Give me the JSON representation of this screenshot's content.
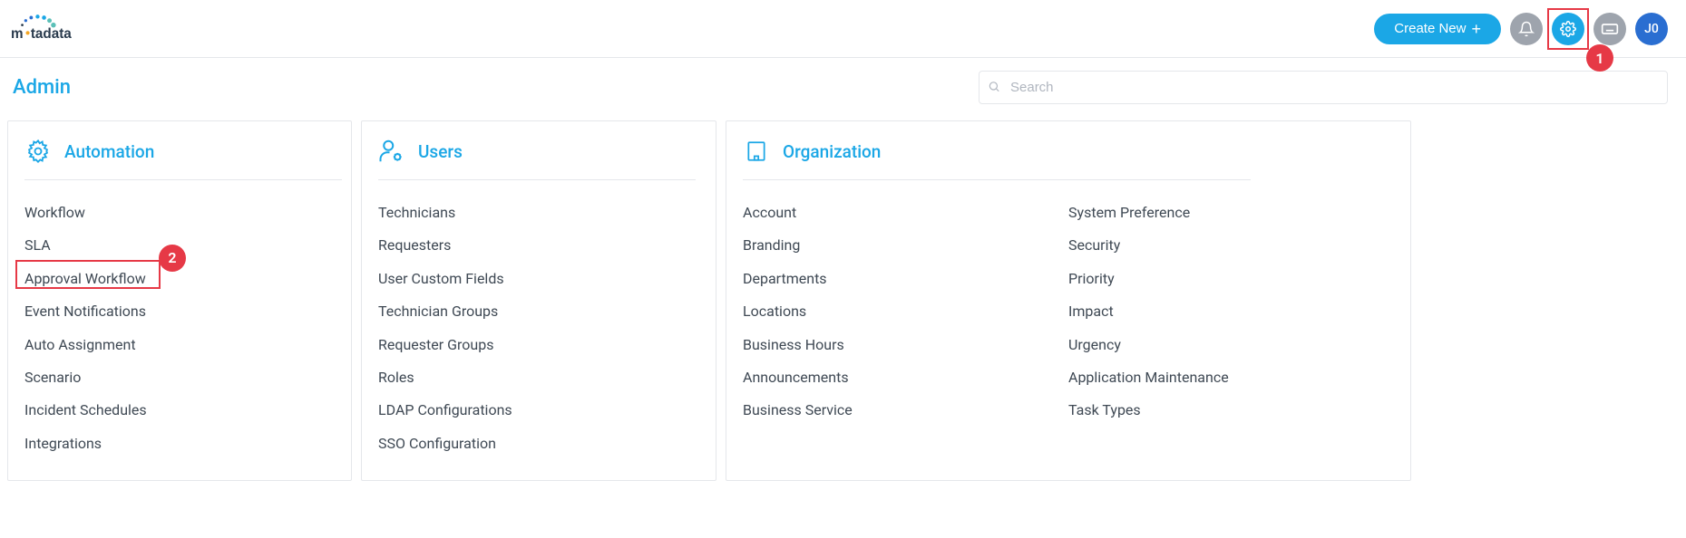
{
  "header": {
    "create_button": "Create New",
    "avatar_initials": "J0"
  },
  "page": {
    "title": "Admin"
  },
  "search": {
    "placeholder": "Search"
  },
  "callouts": {
    "one": "1",
    "two": "2"
  },
  "sections": {
    "automation": {
      "title": "Automation",
      "items": [
        "Workflow",
        "SLA",
        "Approval Workflow",
        "Event Notifications",
        "Auto Assignment",
        "Scenario",
        "Incident Schedules",
        "Integrations"
      ]
    },
    "users": {
      "title": "Users",
      "items": [
        "Technicians",
        "Requesters",
        "User Custom Fields",
        "Technician Groups",
        "Requester Groups",
        "Roles",
        "LDAP Configurations",
        "SSO Configuration"
      ]
    },
    "organization": {
      "title": "Organization",
      "col1": [
        "Account",
        "Branding",
        "Departments",
        "Locations",
        "Business Hours",
        "Announcements",
        "Business Service"
      ],
      "col2": [
        "System Preference",
        "Security",
        "Priority",
        "Impact",
        "Urgency",
        "Application Maintenance",
        "Task Types"
      ]
    }
  }
}
